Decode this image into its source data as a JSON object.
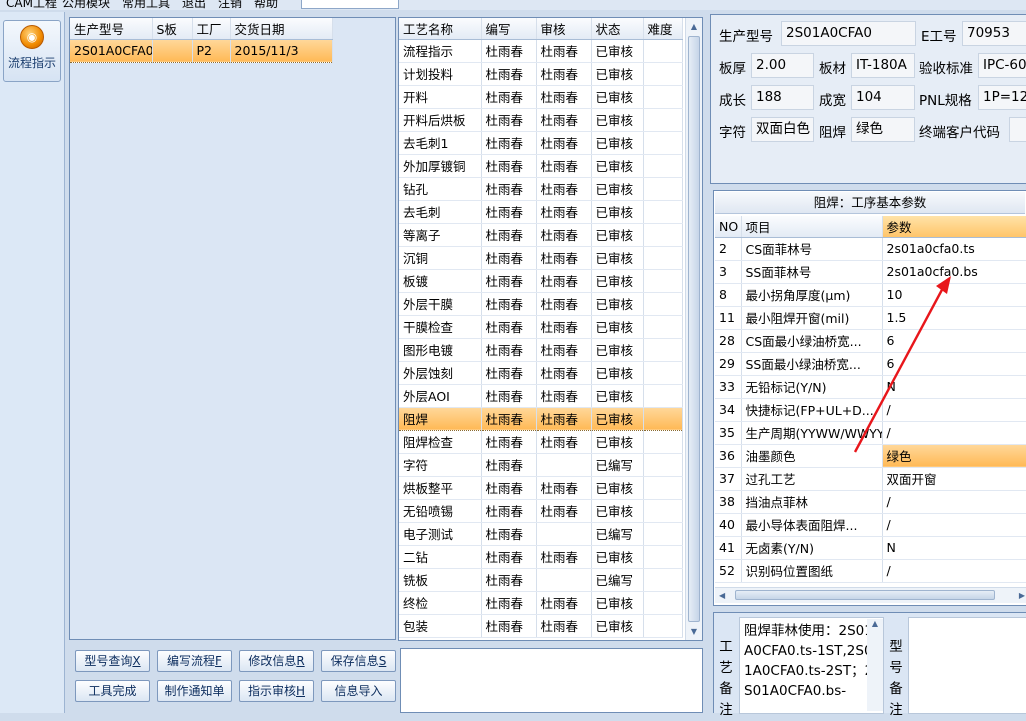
{
  "menu": [
    "CAM工程",
    "公用模块",
    "常用工具",
    "退出",
    "注销",
    "帮助"
  ],
  "leftbar": {
    "flow_label": "流程指示",
    "icon": "orange-round-icon"
  },
  "orders": {
    "columns": [
      "生产型号",
      "S板",
      "工厂",
      "交货日期"
    ],
    "rows": [
      [
        "2S01A0CFA0",
        "",
        "P2",
        "2015/11/3"
      ]
    ]
  },
  "buttons": {
    "row1": [
      [
        "型号查询",
        "X"
      ],
      [
        "编写流程",
        "F"
      ],
      [
        "修改信息",
        "R"
      ],
      [
        "保存信息",
        "S"
      ]
    ],
    "row2": [
      [
        "工具完成",
        ""
      ],
      [
        "制作通知单",
        ""
      ],
      [
        "指示审核",
        "H"
      ],
      [
        "信息导入",
        ""
      ]
    ]
  },
  "process": {
    "columns": [
      "工艺名称",
      "编写",
      "审核",
      "状态",
      "难度"
    ],
    "rows": [
      [
        "流程指示",
        "杜雨春",
        "杜雨春",
        "已审核",
        ""
      ],
      [
        "计划投料",
        "杜雨春",
        "杜雨春",
        "已审核",
        ""
      ],
      [
        "开料",
        "杜雨春",
        "杜雨春",
        "已审核",
        ""
      ],
      [
        "开料后烘板",
        "杜雨春",
        "杜雨春",
        "已审核",
        ""
      ],
      [
        "去毛刺1",
        "杜雨春",
        "杜雨春",
        "已审核",
        ""
      ],
      [
        "外加厚镀铜",
        "杜雨春",
        "杜雨春",
        "已审核",
        ""
      ],
      [
        "钻孔",
        "杜雨春",
        "杜雨春",
        "已审核",
        ""
      ],
      [
        "去毛刺",
        "杜雨春",
        "杜雨春",
        "已审核",
        ""
      ],
      [
        "等离子",
        "杜雨春",
        "杜雨春",
        "已审核",
        ""
      ],
      [
        "沉铜",
        "杜雨春",
        "杜雨春",
        "已审核",
        ""
      ],
      [
        "板镀",
        "杜雨春",
        "杜雨春",
        "已审核",
        ""
      ],
      [
        "外层干膜",
        "杜雨春",
        "杜雨春",
        "已审核",
        ""
      ],
      [
        "干膜检查",
        "杜雨春",
        "杜雨春",
        "已审核",
        ""
      ],
      [
        "图形电镀",
        "杜雨春",
        "杜雨春",
        "已审核",
        ""
      ],
      [
        "外层蚀刻",
        "杜雨春",
        "杜雨春",
        "已审核",
        ""
      ],
      [
        "外层AOI",
        "杜雨春",
        "杜雨春",
        "已审核",
        ""
      ],
      [
        "阻焊",
        "杜雨春",
        "杜雨春",
        "已审核",
        ""
      ],
      [
        "阻焊检查",
        "杜雨春",
        "杜雨春",
        "已审核",
        ""
      ],
      [
        "字符",
        "杜雨春",
        "",
        "已编写",
        ""
      ],
      [
        "烘板整平",
        "杜雨春",
        "杜雨春",
        "已审核",
        ""
      ],
      [
        "无铅喷锡",
        "杜雨春",
        "杜雨春",
        "已审核",
        ""
      ],
      [
        "电子测试",
        "杜雨春",
        "",
        "已编写",
        ""
      ],
      [
        "二钻",
        "杜雨春",
        "杜雨春",
        "已审核",
        ""
      ],
      [
        "铣板",
        "杜雨春",
        "",
        "已编写",
        ""
      ],
      [
        "终检",
        "杜雨春",
        "杜雨春",
        "已审核",
        ""
      ],
      [
        "包装",
        "杜雨春",
        "杜雨春",
        "已审核",
        ""
      ]
    ],
    "selected_index": 16
  },
  "info": {
    "model_label": "生产型号",
    "model_value": "2S01A0CFA0",
    "e_label": "E工号",
    "e_value": "70953",
    "thick_label": "板厚",
    "thick_value": "2.00",
    "material_label": "板材",
    "material_value": "IT-180A",
    "std_label": "验收标准",
    "std_value": "IPC-60",
    "len_label": "成长",
    "len_value": "188",
    "wid_label": "成宽",
    "wid_value": "104",
    "pnl_label": "PNL规格",
    "pnl_value": "1P=12",
    "char_label": "字符",
    "char_value": "双面白色",
    "mask_label": "阻焊",
    "mask_value": "绿色",
    "cust_label": "终端客户代码",
    "cust_value": ""
  },
  "params": {
    "title": "阻焊：工序基本参数",
    "columns": [
      "NO",
      "项目",
      "参数"
    ],
    "rows": [
      [
        "2",
        "CS面菲林号",
        "2s01a0cfa0.ts"
      ],
      [
        "3",
        "SS面菲林号",
        "2s01a0cfa0.bs"
      ],
      [
        "8",
        "最小拐角厚度(μm)",
        "10"
      ],
      [
        "11",
        "最小阻焊开窗(mil)",
        "1.5"
      ],
      [
        "28",
        "CS面最小绿油桥宽...",
        "6"
      ],
      [
        "29",
        "SS面最小绿油桥宽...",
        "6"
      ],
      [
        "33",
        "无铅标记(Y/N)",
        "N"
      ],
      [
        "34",
        "快捷标记(FP+UL+D...",
        "/"
      ],
      [
        "35",
        "生产周期(YYWW/WWYY)",
        "/"
      ],
      [
        "36",
        "油墨颜色",
        "绿色"
      ],
      [
        "37",
        "过孔工艺",
        "双面开窗"
      ],
      [
        "38",
        "挡油点菲林",
        "/"
      ],
      [
        "40",
        "最小导体表面阻焊...",
        "/"
      ],
      [
        "41",
        "无卤素(Y/N)",
        "N"
      ],
      [
        "52",
        "识别码位置图纸",
        "/"
      ]
    ],
    "highlight_index": 9
  },
  "notes": {
    "label": "工艺备注",
    "text": "阻焊菲林使用：2S01A0CFA0.ts-1ST,2S01A0CFA0.ts-2ST；2S01A0CFA0.bs-",
    "label2": "型号备注"
  },
  "annotation": {
    "color": "#e8161b"
  }
}
